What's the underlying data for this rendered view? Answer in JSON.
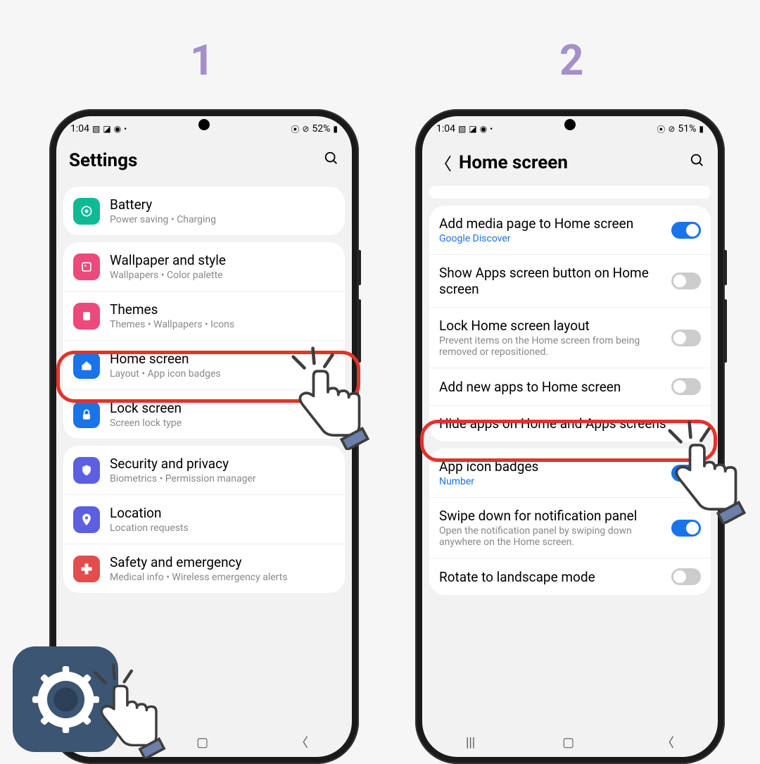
{
  "steps": {
    "one": "1",
    "two": "2"
  },
  "status1": {
    "time": "1:04",
    "battery": "52%"
  },
  "status2": {
    "time": "1:04",
    "battery": "51%"
  },
  "phone1": {
    "header": "Settings",
    "rows": {
      "battery": {
        "title": "Battery",
        "sub": "Power saving  •  Charging"
      },
      "wallpaper": {
        "title": "Wallpaper and style",
        "sub": "Wallpapers  •  Color palette"
      },
      "themes": {
        "title": "Themes",
        "sub": "Themes  •  Wallpapers  •  Icons"
      },
      "home": {
        "title": "Home screen",
        "sub": "Layout  •  App icon badges"
      },
      "lock": {
        "title": "Lock screen",
        "sub": "Screen lock type"
      },
      "security": {
        "title": "Security and privacy",
        "sub": "Biometrics  •  Permission manager"
      },
      "location": {
        "title": "Location",
        "sub": "Location requests"
      },
      "safety": {
        "title": "Safety and emergency",
        "sub": "Medical info  •  Wireless emergency alerts"
      }
    }
  },
  "phone2": {
    "header": "Home screen",
    "rows": {
      "media": {
        "title": "Add media page to Home screen",
        "sub": "Google Discover"
      },
      "appsbtn": {
        "title": "Show Apps screen button on Home screen"
      },
      "locklayout": {
        "title": "Lock Home screen layout",
        "sub": "Prevent items on the Home screen from being removed or repositioned."
      },
      "addnew": {
        "title": "Add new apps to Home screen"
      },
      "hide": {
        "title": "Hide apps on Home and Apps screens"
      },
      "badges": {
        "title": "App icon badges",
        "sub": "Number"
      },
      "swipe": {
        "title": "Swipe down for notification panel",
        "sub": "Open the notification panel by swiping down anywhere on the Home screen."
      },
      "rotate": {
        "title": "Rotate to landscape mode"
      }
    }
  }
}
